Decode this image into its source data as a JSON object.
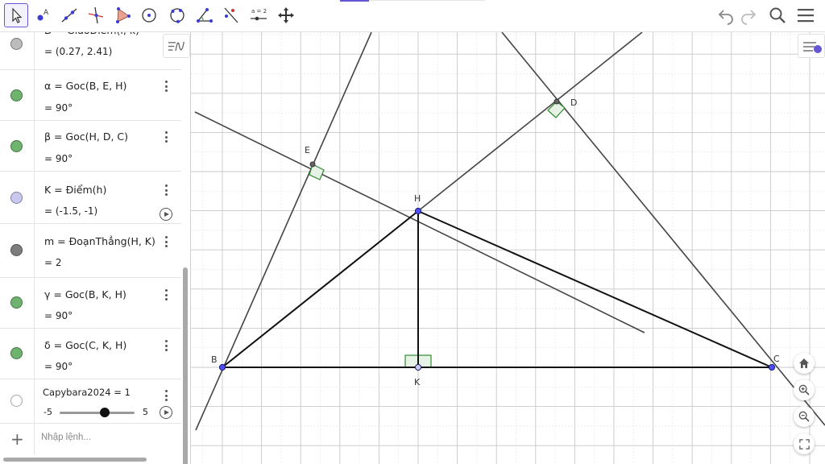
{
  "algebra": {
    "rows": [
      {
        "def": "D = GiaoĐiểm(l, k)",
        "value": "= (0.27, 2.41)",
        "color": "#bcbcbc"
      },
      {
        "def": "α = Goc(B, E, H)",
        "value": "= 90°",
        "color": "#6eb36e"
      },
      {
        "def": "β = Goc(H, D, C)",
        "value": "= 90°",
        "color": "#6eb36e"
      },
      {
        "def": "K = Điểm(h)",
        "value": "= (-1.5, -1)",
        "color": "#c8c8f0"
      },
      {
        "def": "m = ĐoạnThẳng(H, K)",
        "value": "= 2",
        "color": "#7d7d7d"
      },
      {
        "def": "γ = Goc(B, K, H)",
        "value": "= 90°",
        "color": "#6eb36e"
      },
      {
        "def": "δ = Goc(C, K, H)",
        "value": "= 90°",
        "color": "#6eb36e"
      }
    ],
    "slider": {
      "def": "Capybara2024 = 1",
      "min": "-5",
      "max": "5",
      "value": 1,
      "color": "#ffffff"
    },
    "input_placeholder": "Nhập lệnh...",
    "add_symbol": "+"
  },
  "graphics": {
    "point_labels": {
      "B": "B",
      "C": "C",
      "D": "D",
      "E": "E",
      "H": "H",
      "K": "K"
    },
    "colors": {
      "point": "#4d4dff",
      "angle_fill": "#e6f2e6",
      "angle_stroke": "#2e8b2e",
      "line": "#444444",
      "segment": "#111111",
      "grid_major": "#c8c8c8",
      "grid_minor": "#e6e6e6"
    }
  },
  "toolbar": {
    "tools": [
      "move-tool",
      "point-tool",
      "line-tool",
      "perpendicular-tool",
      "polygon-tool",
      "circle-tool",
      "circle-three-points-tool",
      "angle-tool",
      "reflect-tool",
      "slider-tool",
      "move-graphics-tool"
    ],
    "slider_tool_label": "a = 2",
    "accent": "#6557d2"
  }
}
